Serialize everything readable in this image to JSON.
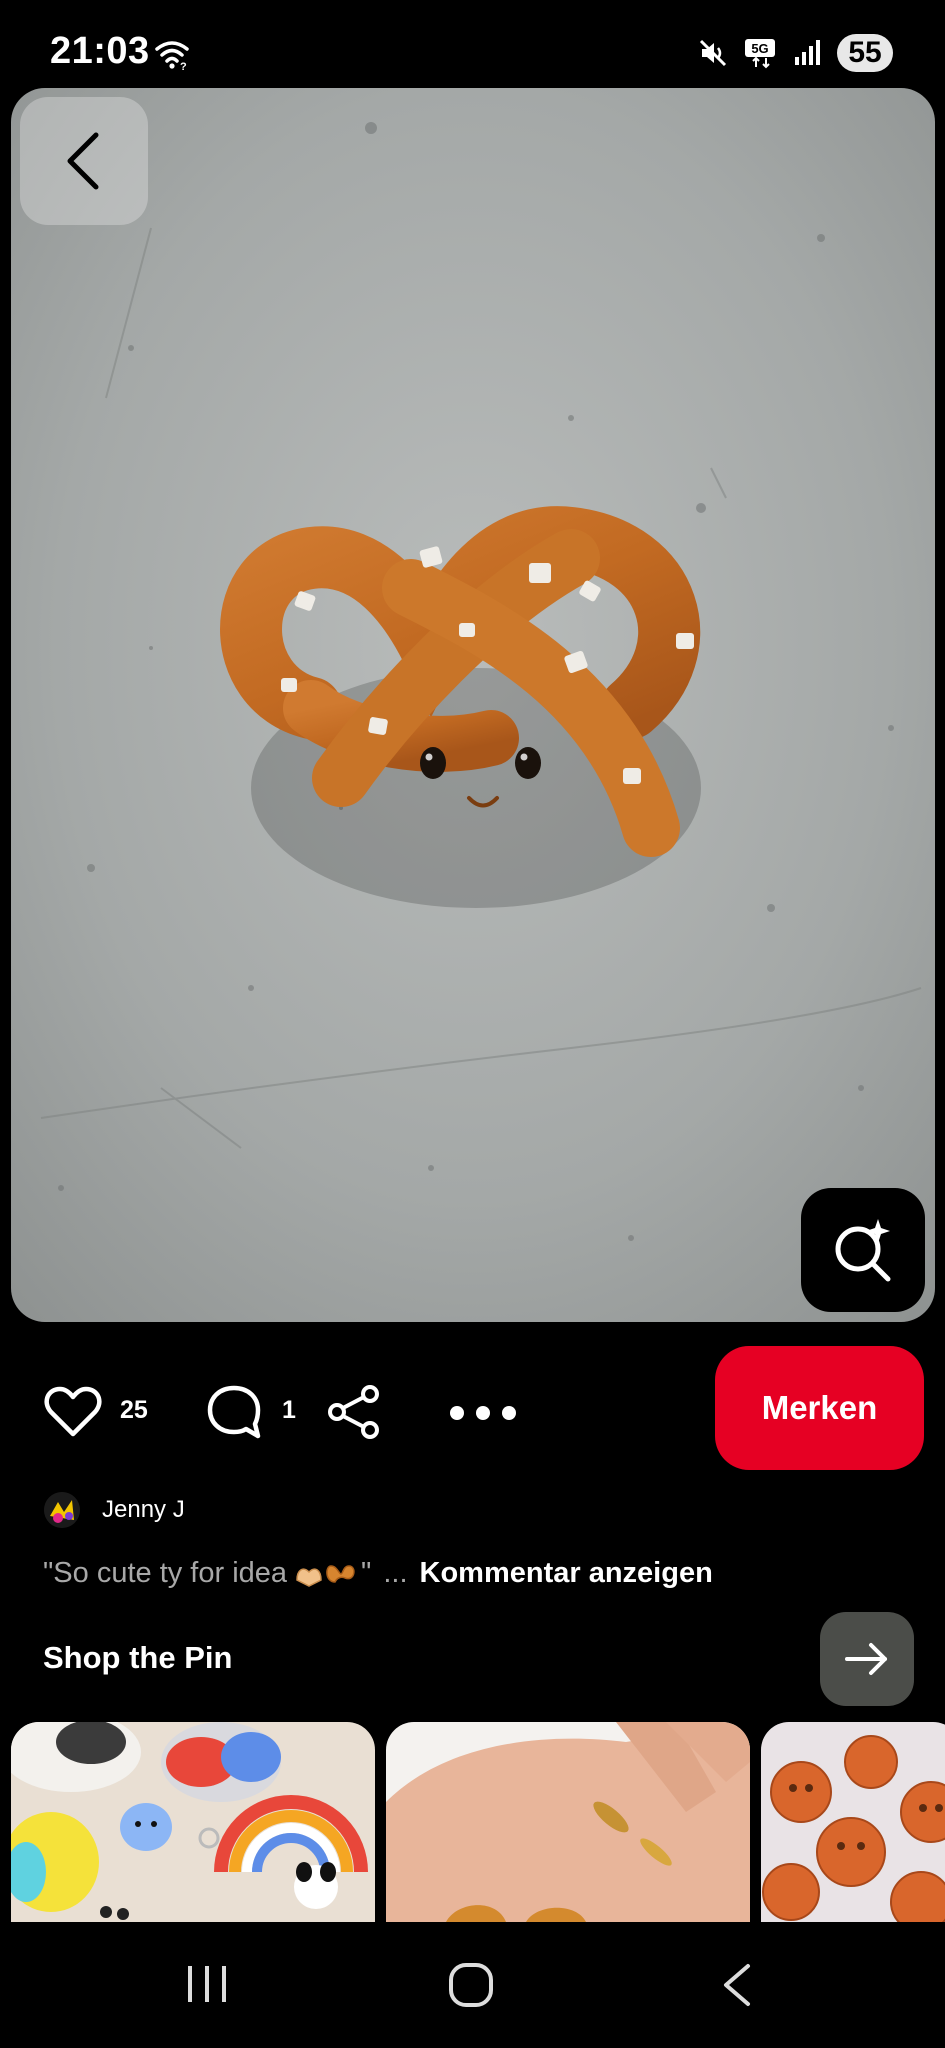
{
  "status_bar": {
    "time": "21:03",
    "network_label": "5G",
    "battery": "55",
    "icons": [
      "wifi-icon",
      "mute-icon",
      "fiveg-icon",
      "signal-icon"
    ]
  },
  "pin": {
    "image_subject": "pretzel-clay-figure",
    "back_icon": "chevron-left-icon",
    "lens_icon": "visual-search-sparkle-icon"
  },
  "actions": {
    "like_count": "25",
    "comment_count": "1",
    "save_label": "Merken",
    "save_color": "#e60023"
  },
  "creator": {
    "name": "Jenny J"
  },
  "comment": {
    "text": "\"So cute ty for idea",
    "emoji": "🫶🥨",
    "quote_end": "\"",
    "ellipsis": "...",
    "link_label": "Kommentar anzeigen"
  },
  "shop": {
    "title": "Shop the Pin",
    "arrow_icon": "arrow-right-icon",
    "products": [
      {
        "subject": "clay-craft-kit"
      },
      {
        "subject": "hand-with-clay-pretzels"
      },
      {
        "subject": "clay-pumpkins"
      }
    ]
  },
  "navigation": {
    "items": [
      "recent-apps-icon",
      "home-icon",
      "back-icon"
    ]
  }
}
